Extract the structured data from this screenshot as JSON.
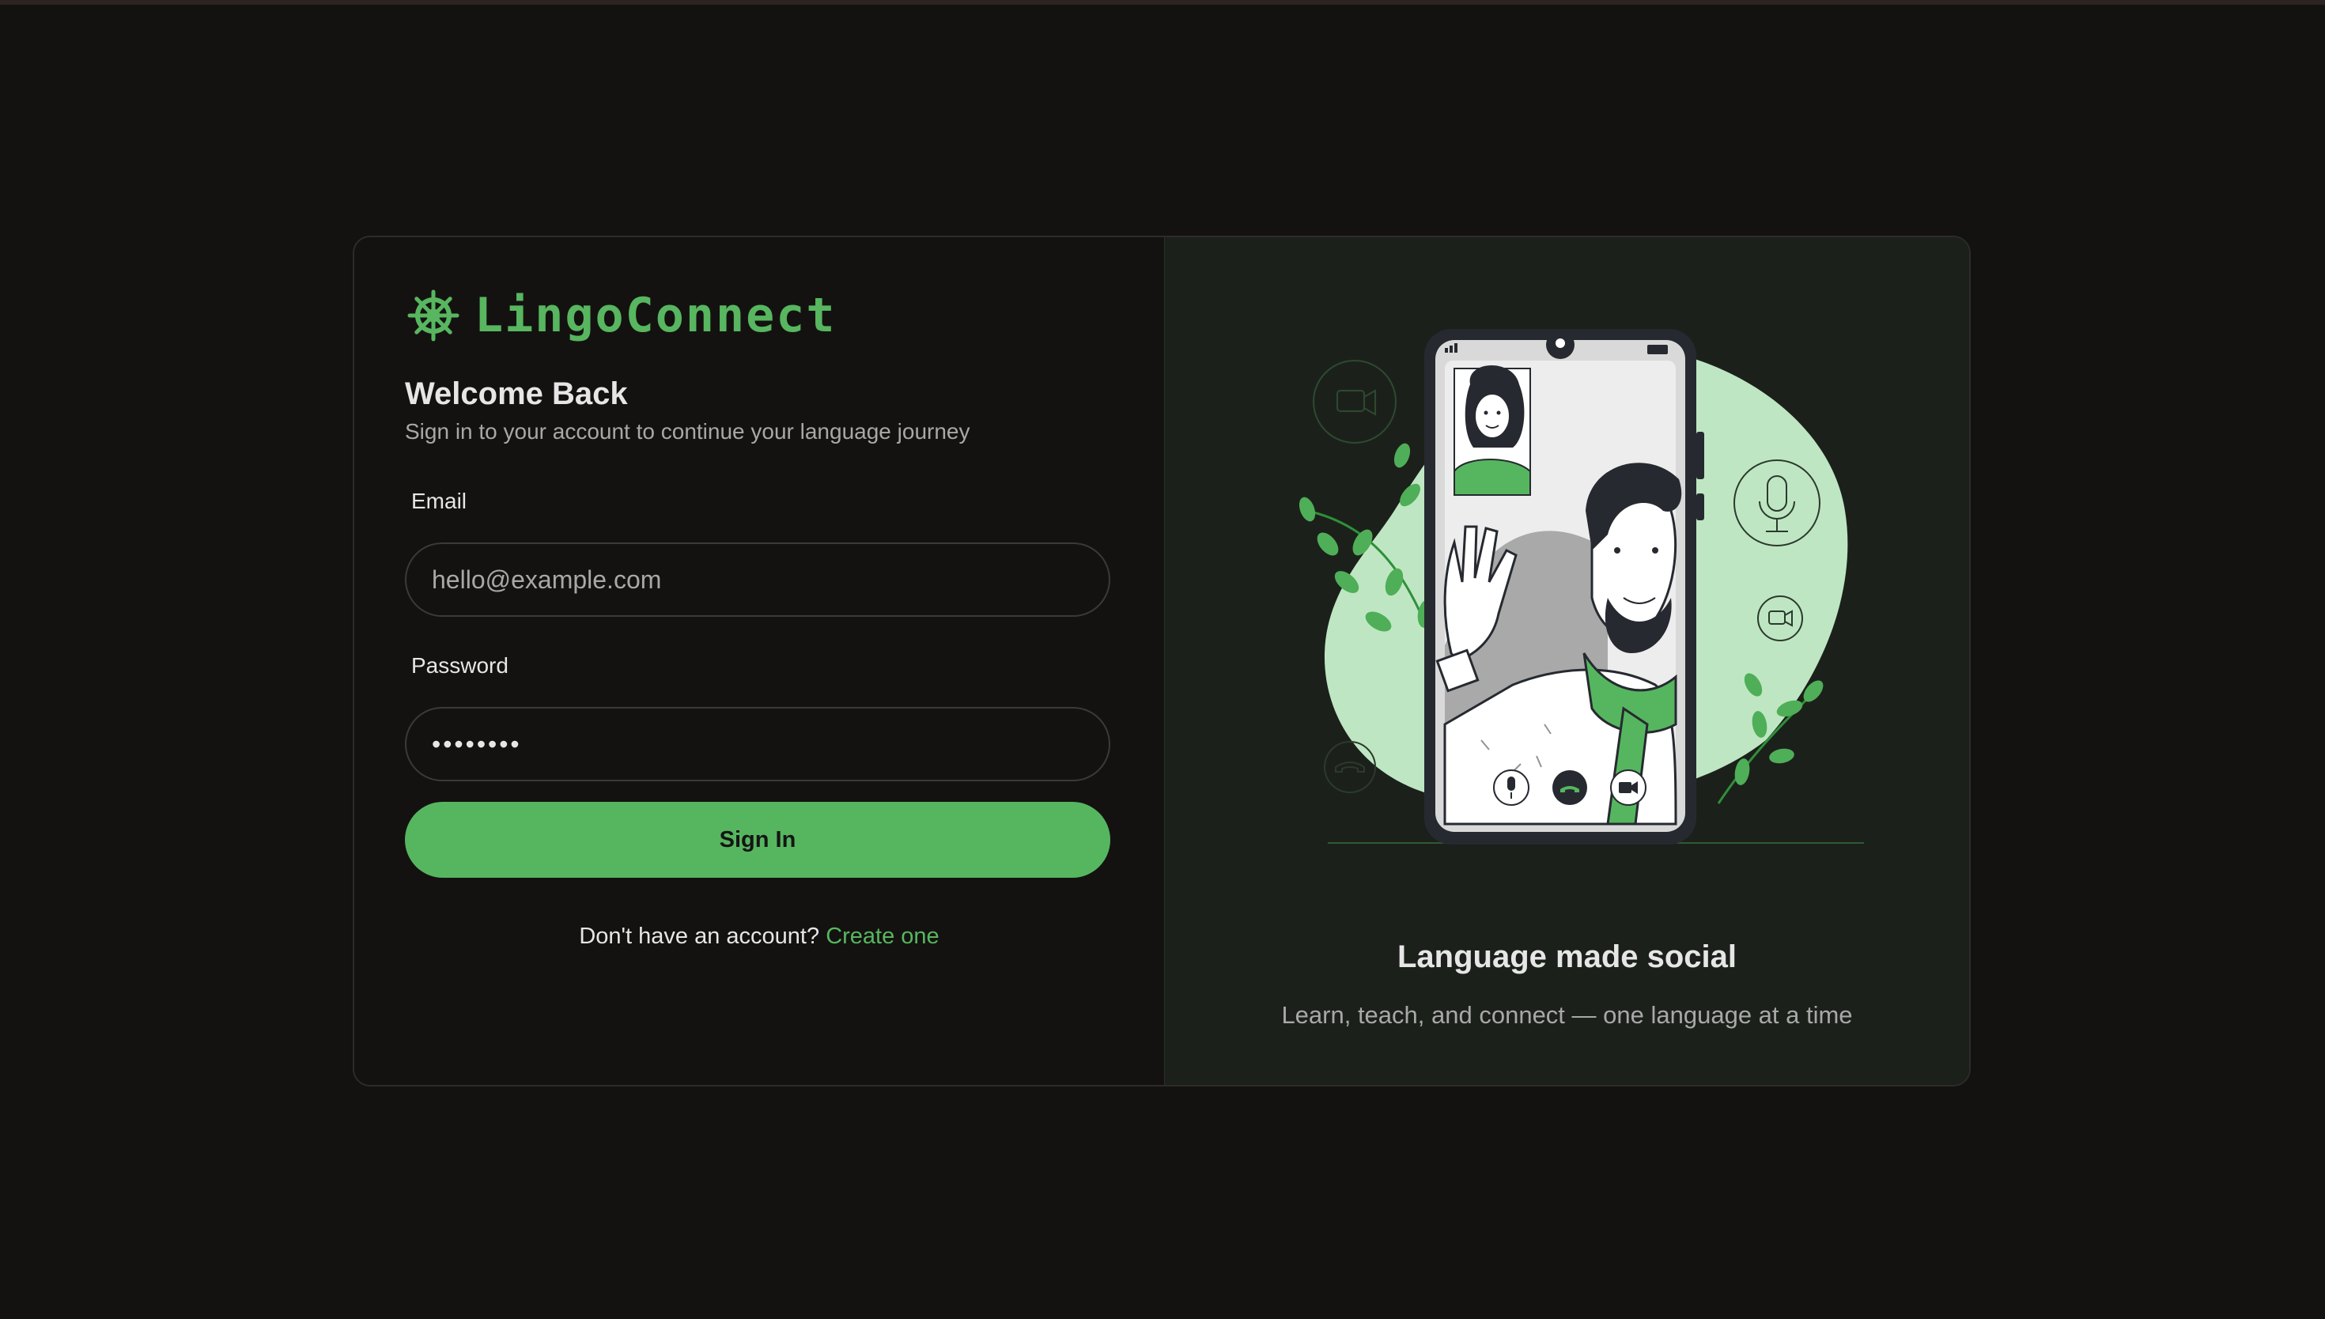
{
  "brand": {
    "name": "LingoConnect",
    "logo_icon": "ship-wheel-icon",
    "color": "#57b65f"
  },
  "login": {
    "title": "Welcome Back",
    "subtitle": "Sign in to your account to continue your language journey",
    "email_label": "Email",
    "email_placeholder": "hello@example.com",
    "password_label": "Password",
    "password_value": "••••••••",
    "submit_label": "Sign In",
    "signup_prompt": "Don't have an account?",
    "signup_link": "Create one"
  },
  "promo": {
    "illustration": "video-call-illustration",
    "title": "Language made social",
    "subtitle": "Learn, teach, and connect — one language at a time"
  },
  "colors": {
    "accent": "#56b65f",
    "background": "#141211",
    "panel": "#1c201b"
  }
}
